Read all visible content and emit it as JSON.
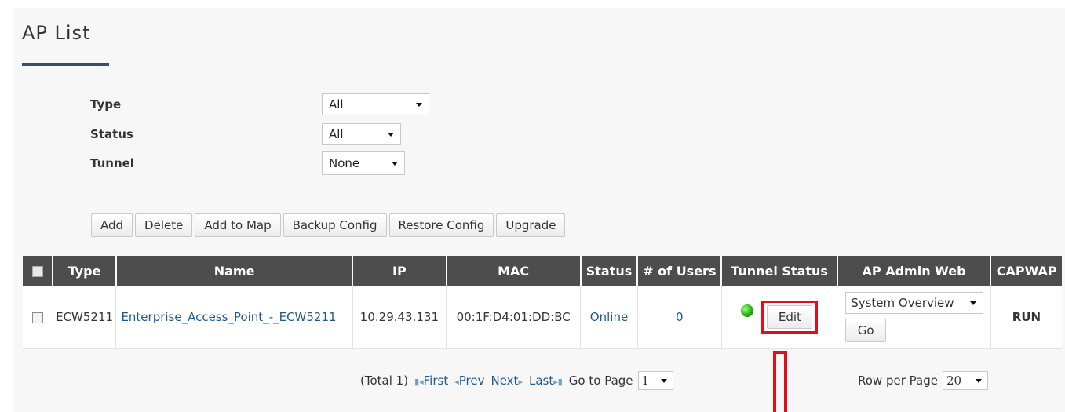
{
  "page": {
    "title": "AP List"
  },
  "filters": {
    "type": {
      "label": "Type",
      "value": "All"
    },
    "status": {
      "label": "Status",
      "value": "All"
    },
    "tunnel": {
      "label": "Tunnel",
      "value": "None"
    }
  },
  "toolbar": {
    "add": "Add",
    "delete": "Delete",
    "add_to_map": "Add to Map",
    "backup_config": "Backup Config",
    "restore_config": "Restore Config",
    "upgrade": "Upgrade"
  },
  "table": {
    "headers": {
      "type": "Type",
      "name": "Name",
      "ip": "IP",
      "mac": "MAC",
      "status": "Status",
      "users": "# of Users",
      "tunnel_status": "Tunnel Status",
      "admin_web": "AP Admin Web",
      "capwap": "CAPWAP"
    },
    "rows": [
      {
        "type": "ECW5211",
        "name": "Enterprise_Access_Point_-_ECW5211",
        "ip": "10.29.43.131",
        "mac": "00:1F:D4:01:DD:BC",
        "status": "Online",
        "users": "0",
        "tunnel_edit": "Edit",
        "admin_web": "System Overview",
        "go": "Go",
        "capwap": "RUN"
      }
    ]
  },
  "pager": {
    "total": "(Total 1)",
    "first": "First",
    "prev": "Prev",
    "next": "Next",
    "last": "Last",
    "go_to_page_label": "Go to Page",
    "page_value": "1",
    "rows_per_page_label": "Row per Page",
    "rows_per_page_value": "20"
  },
  "colors": {
    "header_bg": "#4d4d4d",
    "link": "#1f5a8a",
    "highlight": "#e0101a",
    "status_led": "#2fbf1f"
  }
}
